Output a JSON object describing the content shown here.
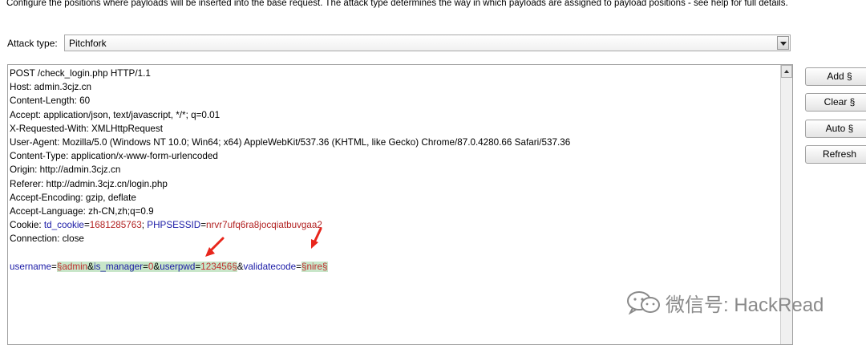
{
  "description": "Configure the positions where payloads will be inserted into the base request. The attack type determines the way in which payloads are assigned to payload positions - see help for full details.",
  "attack_type": {
    "label": "Attack type:",
    "value": "Pitchfork"
  },
  "request": {
    "request_line": "POST /check_login.php HTTP/1.1",
    "headers": [
      "Host: admin.3cjz.cn",
      "Content-Length: 60",
      "Accept: application/json, text/javascript, */*; q=0.01",
      "X-Requested-With: XMLHttpRequest",
      "User-Agent: Mozilla/5.0 (Windows NT 10.0; Win64; x64) AppleWebKit/537.36 (KHTML, like Gecko) Chrome/87.0.4280.66 Safari/537.36",
      "Content-Type: application/x-www-form-urlencoded",
      "Origin: http://admin.3cjz.cn",
      "Referer: http://admin.3cjz.cn/login.php",
      "Accept-Encoding: gzip, deflate",
      "Accept-Language: zh-CN,zh;q=0.9"
    ],
    "cookie": {
      "label": "Cookie:",
      "td_name": "td_cookie",
      "td_value": "1681285763",
      "sess_name": "PHPSESSID",
      "sess_value": "nrvr7ufq6ra8jocqiatbuvgaa2"
    },
    "connection": "Connection: close",
    "body": {
      "username_key": "username",
      "username_marked": "§admin&is_manager=0&userpwd=123456§",
      "username_seg1": "admin",
      "ismgr_key": "is_manager",
      "ismgr_val": "0",
      "pwd_key": "userpwd",
      "pwd_val": "123456",
      "vc_key": "validatecode",
      "vc_val": "nire"
    }
  },
  "buttons": {
    "add": "Add §",
    "clear": "Clear §",
    "auto": "Auto §",
    "refresh": "Refresh"
  },
  "watermark": "微信号: HackRead",
  "colors": {
    "arrow": "#e8261c",
    "highlight": "#c8e6c9"
  }
}
